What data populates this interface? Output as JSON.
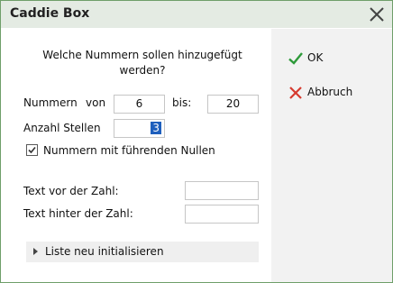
{
  "window": {
    "title": "Caddie Box"
  },
  "form": {
    "question": "Welche Nummern sollen hinzugefügt werden?",
    "nummern_label": "Nummern",
    "von_label": "von",
    "von_value": "6",
    "bis_label": "bis:",
    "bis_value": "20",
    "stellen_label": "Anzahl Stellen",
    "stellen_value": "3",
    "leading_zeros_label": "Nummern mit führenden Nullen",
    "leading_zeros_checked": true,
    "text_vor_label": "Text vor der Zahl:",
    "text_vor_value": "",
    "text_hinter_label": "Text hinter der Zahl:",
    "text_hinter_value": "",
    "expander_label": "Liste neu initialisieren"
  },
  "buttons": {
    "ok_label": "OK",
    "cancel_label": "Abbruch",
    "ok_icon": "check-icon",
    "cancel_icon": "x-icon",
    "ok_color": "#2e9a3a",
    "cancel_color": "#d63a2f"
  }
}
